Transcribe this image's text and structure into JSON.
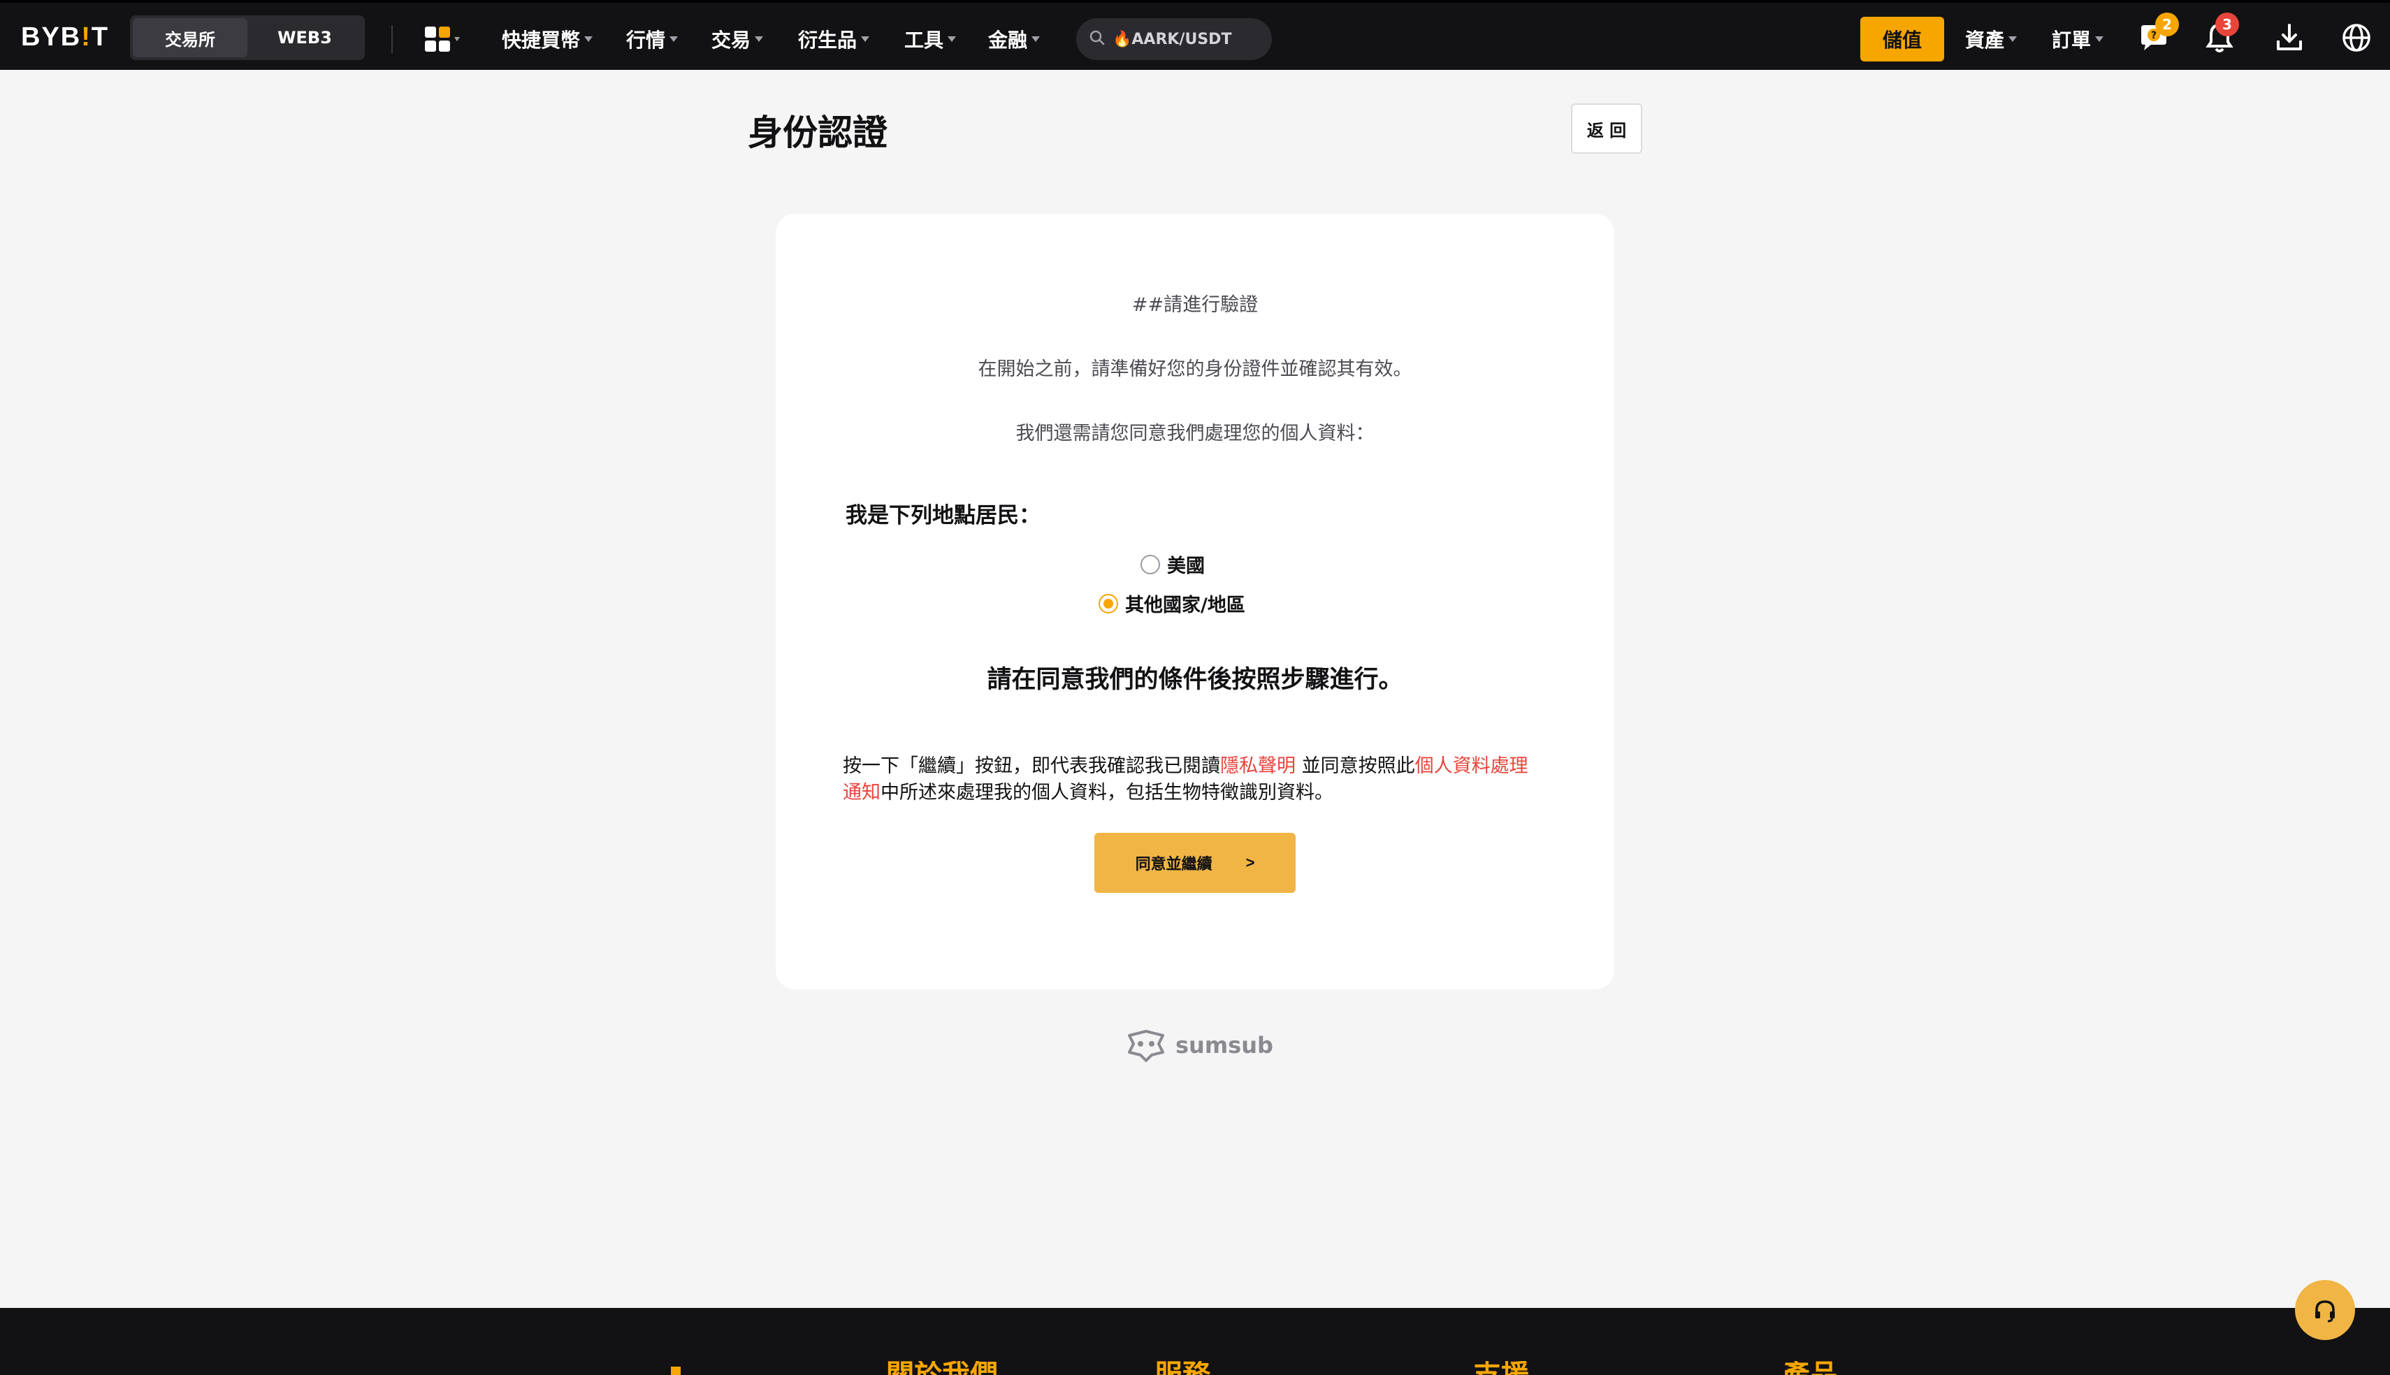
{
  "header": {
    "logo": "BYB",
    "logo_bar": "!",
    "logo_end": "T",
    "segments": [
      "交易所",
      "WEB3"
    ],
    "nav": [
      "快捷買幣",
      "行情",
      "交易",
      "衍生品",
      "工具",
      "金融"
    ],
    "search_placeholder": "🔥AARK/USDT",
    "deposit_label": "儲值",
    "assets_label": "資產",
    "orders_label": "訂單",
    "help_badge": "2",
    "notif_badge": "3"
  },
  "page": {
    "title": "身份認證",
    "back_label": "返 回"
  },
  "card": {
    "heading": "##請進行驗證",
    "line1": "在開始之前，請準備好您的身份證件並確認其有效。",
    "line2": "我們還需請您同意我們處理您的個人資料：",
    "resident_label": "我是下列地點居民：",
    "options": [
      {
        "label": "美國",
        "checked": false
      },
      {
        "label": "其他國家/地區",
        "checked": true
      }
    ],
    "instruction": "請在同意我們的條件後按照步驟進行。",
    "consent": {
      "part1": "按一下「繼續」按鈕，即代表我確認我已閱讀",
      "privacy_link": "隱私聲明",
      "part2": " 並同意按照此",
      "notice_link": "個人資料處理通知",
      "part3": "中所述來處理我的個人資料，包括生物特徵識別資料。"
    },
    "agree_label": "同意並繼續",
    "agree_arrow": ">"
  },
  "powered_by": "sumsub",
  "footer": {
    "columns": [
      "關於我們",
      "服務",
      "支援",
      "產品"
    ]
  },
  "colors": {
    "brand": "#f7a600",
    "button": "#f0b545",
    "link": "#e8453c",
    "topbar": "#121214"
  }
}
